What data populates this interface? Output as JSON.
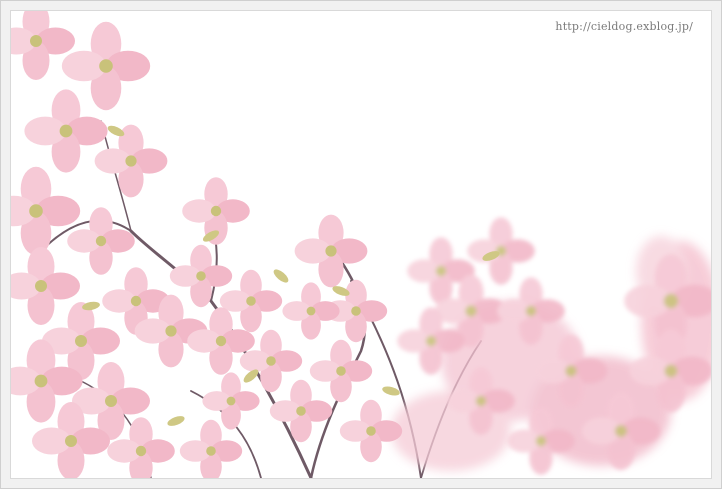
{
  "photo": {
    "subject": "pink-dogwood-blossoms",
    "watermark": "http://cieldog.exblog.jp/"
  },
  "colors": {
    "background": "#ffffff",
    "frame": "#f1f1f1",
    "petal_light": "#f7d3dd",
    "petal_mid": "#f2b6c7",
    "petal_deep": "#e98fa7",
    "leaf": "#c9c27a",
    "branch": "#6f5a66"
  }
}
